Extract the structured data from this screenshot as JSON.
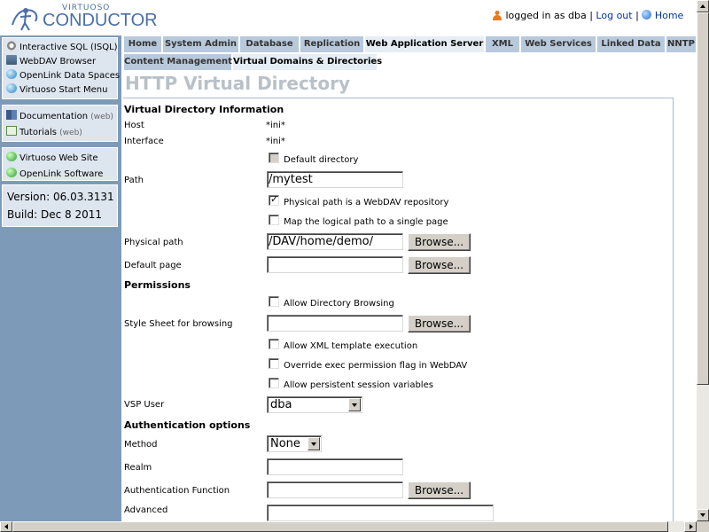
{
  "header": {
    "brand_small": "VIRTUOSO",
    "brand_big": "CONDUCTOR",
    "logged_in_text": "logged in as dba",
    "separator": "|",
    "logout_label": "Log out",
    "home_label": "Home"
  },
  "sidebar": {
    "group1": [
      {
        "label": "Interactive SQL (ISQL)",
        "icon": "gear-icon"
      },
      {
        "label": "WebDAV Browser",
        "icon": "folder-icon"
      },
      {
        "label": "OpenLink Data Spaces",
        "icon": "globe-icon"
      },
      {
        "label": "Virtuoso Start Menu",
        "icon": "globe-icon"
      }
    ],
    "group2": [
      {
        "label": "Documentation",
        "sub": "(web)",
        "icon": "book-icon"
      },
      {
        "label": "Tutorials",
        "sub": "(web)",
        "icon": "tutorial-icon"
      }
    ],
    "group3": [
      {
        "label": "Virtuoso Web Site",
        "icon": "earth-icon"
      },
      {
        "label": "OpenLink Software",
        "icon": "earth-icon"
      }
    ],
    "version": "Version: 06.03.3131",
    "build": "Build: Dec 8 2011"
  },
  "tabs": [
    {
      "label": "Home"
    },
    {
      "label": "System Admin"
    },
    {
      "label": "Database"
    },
    {
      "label": "Replication"
    },
    {
      "label": "Web Application Server",
      "active": true
    },
    {
      "label": "XML"
    },
    {
      "label": "Web Services"
    },
    {
      "label": "Linked Data"
    },
    {
      "label": "NNTP"
    }
  ],
  "subtabs": [
    {
      "label": "Content Management"
    },
    {
      "label": "Virtual Domains & Directories",
      "active": true
    }
  ],
  "page_title": "HTTP Virtual Directory",
  "form": {
    "section_info": "Virtual Directory Information",
    "host_label": "Host",
    "host_value": "*ini*",
    "interface_label": "Interface",
    "interface_value": "*ini*",
    "default_dir_label": "Default directory",
    "path_label": "Path",
    "path_value": "/mytest",
    "webdav_label": "Physical path is a WebDAV repository",
    "map_logical_label": "Map the logical path to a single page",
    "physical_path_label": "Physical path",
    "physical_path_value": "/DAV/home/demo/",
    "browse_label": "Browse...",
    "default_page_label": "Default page",
    "default_page_value": "",
    "section_permissions": "Permissions",
    "allow_dir_browsing_label": "Allow Directory Browsing",
    "stylesheet_label": "Style Sheet for browsing",
    "stylesheet_value": "",
    "allow_xml_template_label": "Allow XML template execution",
    "override_exec_label": "Override exec permission flag in WebDAV",
    "allow_persistent_label": "Allow persistent session variables",
    "vsp_user_label": "VSP User",
    "vsp_user_value": "dba",
    "section_auth": "Authentication options",
    "method_label": "Method",
    "method_value": "None",
    "realm_label": "Realm",
    "realm_value": "",
    "auth_function_label": "Authentication Function",
    "auth_function_value": "",
    "advanced_label": "Advanced",
    "advanced_value": ""
  }
}
